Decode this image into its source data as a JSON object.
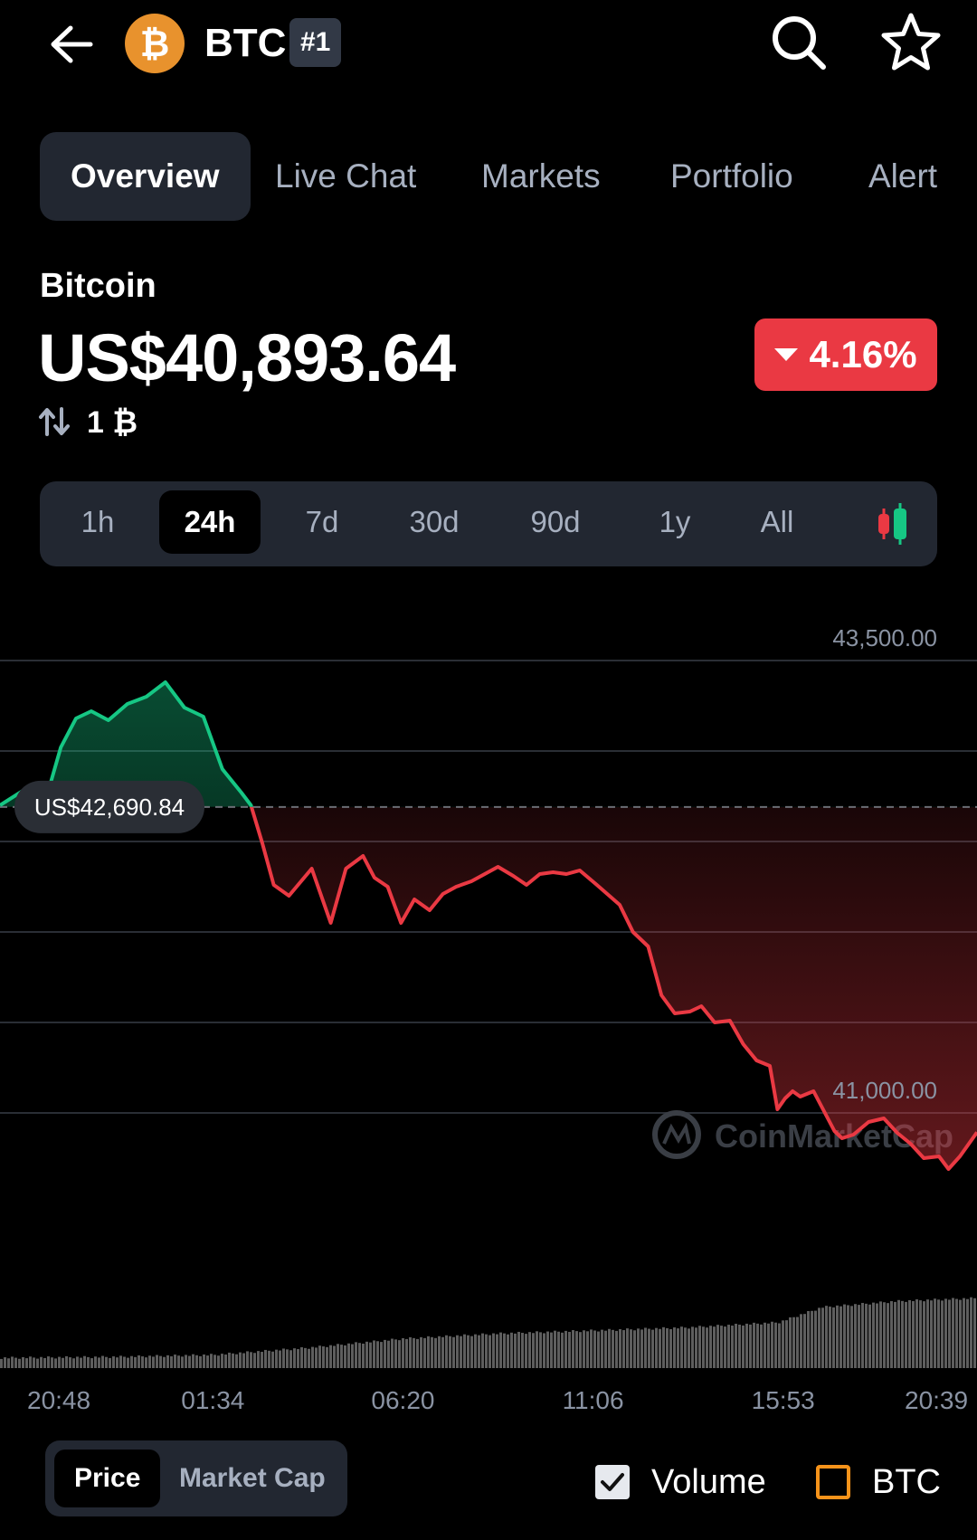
{
  "header": {
    "ticker": "BTC",
    "rank": "#1",
    "icons": [
      "arrow-left-icon",
      "bitcoin-logo",
      "search-icon",
      "star-icon"
    ],
    "colors": {
      "bitcoin": "#E8922D",
      "badge_bg": "#323946"
    }
  },
  "tabs": [
    {
      "label": "Overview",
      "active": true
    },
    {
      "label": "Live Chat",
      "active": false
    },
    {
      "label": "Markets",
      "active": false
    },
    {
      "label": "Portfolio",
      "active": false
    },
    {
      "label": "Alert",
      "active": false
    }
  ],
  "coin": {
    "name": "Bitcoin",
    "price": "US$40,893.64",
    "change": "4.16%",
    "change_direction": "down",
    "converter_value": "1 ₿",
    "converter_icon": "swap-vertical-icon"
  },
  "ranges": [
    {
      "label": "1h",
      "active": false
    },
    {
      "label": "24h",
      "active": true
    },
    {
      "label": "7d",
      "active": false
    },
    {
      "label": "30d",
      "active": false
    },
    {
      "label": "90d",
      "active": false
    },
    {
      "label": "1y",
      "active": false
    },
    {
      "label": "All",
      "active": false
    }
  ],
  "candle_toggle_icon": "candlestick-icon",
  "chart_data": {
    "type": "area",
    "title": "",
    "xlabel": "",
    "ylabel": "",
    "reference_label": "US$42,690.84",
    "reference_value": 42690.84,
    "y_tick_labels": [
      {
        "value": 43500,
        "label": "43,500.00"
      },
      {
        "value": 41000,
        "label": "41,000.00"
      }
    ],
    "ylim": [
      40550,
      43750
    ],
    "x_tick_labels": [
      "20:48",
      "01:34",
      "06:20",
      "11:06",
      "15:53",
      "20:39"
    ],
    "x_range": [
      -0.12,
      5.02
    ],
    "grid": true,
    "watermark": "CoinMarketCap",
    "colors": {
      "up": "#16C784",
      "down": "#EA3943",
      "volume": "#5E5E5E",
      "grid": "#2A2E35"
    },
    "series": [
      {
        "x": [
          -0.12,
          0.0,
          0.07,
          0.14,
          0.2,
          0.28,
          0.36,
          0.45,
          0.55,
          0.65,
          0.75,
          0.85,
          0.95,
          1.05,
          1.15,
          1.2,
          1.26,
          1.32,
          1.4,
          1.52,
          1.62,
          1.7,
          1.79,
          1.85,
          1.92,
          1.99,
          2.06,
          2.14,
          2.21,
          2.28,
          2.36,
          2.43,
          2.5,
          2.58,
          2.65,
          2.72,
          2.79,
          2.86,
          2.93,
          3.02,
          3.14,
          3.21,
          3.29,
          3.36,
          3.43,
          3.51,
          3.57,
          3.64,
          3.72,
          3.79,
          3.86,
          3.93,
          3.97,
          4.01,
          4.05,
          4.09,
          4.16,
          4.23,
          4.27,
          4.31,
          4.37,
          4.45,
          4.53,
          4.6,
          4.67,
          4.74,
          4.82,
          4.87,
          4.93,
          5.02
        ],
        "y": [
          42700,
          42780,
          42770,
          42800,
          43020,
          43180,
          43220,
          43170,
          43260,
          43300,
          43380,
          43240,
          43190,
          42900,
          42770,
          42700,
          42490,
          42260,
          42200,
          42350,
          42050,
          42350,
          42420,
          42300,
          42250,
          42050,
          42180,
          42120,
          42210,
          42250,
          42280,
          42320,
          42360,
          42310,
          42260,
          42320,
          42330,
          42320,
          42340,
          42260,
          42150,
          42000,
          41920,
          41650,
          41550,
          41560,
          41590,
          41500,
          41510,
          41380,
          41290,
          41260,
          41020,
          41080,
          41120,
          41090,
          41120,
          40980,
          40900,
          40860,
          40880,
          40950,
          40970,
          40890,
          40830,
          40750,
          40760,
          40690,
          40760,
          40893
        ]
      }
    ],
    "volume": {
      "x": [
        -0.12,
        0.5,
        1.0,
        1.5,
        2.0,
        2.5,
        3.0,
        3.5,
        3.97,
        4.2,
        4.6,
        5.02
      ],
      "values": [
        9,
        10,
        12,
        19,
        28,
        33,
        36,
        39,
        44,
        59,
        65,
        68
      ]
    }
  },
  "bottom": {
    "toggle": [
      "Price",
      "Market Cap"
    ],
    "volume_label": "Volume",
    "volume_checked": true,
    "btc_label": "BTC",
    "btc_checked": false
  }
}
